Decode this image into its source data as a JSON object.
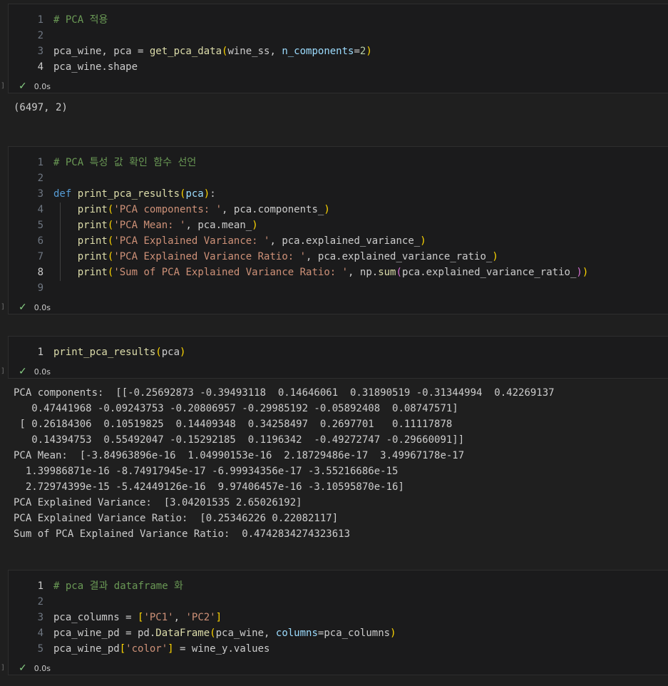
{
  "cells": [
    {
      "lines": [
        {
          "n": "1",
          "parts": [
            [
              "cm",
              "# PCA 적용"
            ]
          ]
        },
        {
          "n": "2",
          "parts": []
        },
        {
          "n": "3",
          "parts": [
            [
              "t",
              "pca_wine, pca = "
            ],
            [
              "fn",
              "get_pca_data"
            ],
            [
              "b1",
              "("
            ],
            [
              "t",
              "wine_ss, "
            ],
            [
              "prm",
              "n_components"
            ],
            [
              "t",
              "="
            ],
            [
              "num",
              "2"
            ],
            [
              "b1",
              ")"
            ]
          ]
        },
        {
          "n": "4",
          "parts": [
            [
              "t",
              "pca_wine.shape"
            ]
          ],
          "active": true
        }
      ],
      "status": "0.0s",
      "output": "(6497, 2)"
    },
    {
      "lines": [
        {
          "n": "1",
          "parts": [
            [
              "cm",
              "# PCA 특성 값 확인 함수 선언"
            ]
          ]
        },
        {
          "n": "2",
          "parts": []
        },
        {
          "n": "3",
          "parts": [
            [
              "kw",
              "def "
            ],
            [
              "fn",
              "print_pca_results"
            ],
            [
              "b1",
              "("
            ],
            [
              "prm",
              "pca"
            ],
            [
              "b1",
              ")"
            ],
            [
              "t",
              ":"
            ]
          ]
        },
        {
          "n": "4",
          "parts": [
            [
              "t",
              "    "
            ],
            [
              "fn",
              "print"
            ],
            [
              "b1",
              "("
            ],
            [
              "str",
              "'PCA components: '"
            ],
            [
              "t",
              ", pca.components_"
            ],
            [
              "b1",
              ")"
            ]
          ]
        },
        {
          "n": "5",
          "parts": [
            [
              "t",
              "    "
            ],
            [
              "fn",
              "print"
            ],
            [
              "b1",
              "("
            ],
            [
              "str",
              "'PCA Mean: '"
            ],
            [
              "t",
              ", pca.mean_"
            ],
            [
              "b1",
              ")"
            ]
          ]
        },
        {
          "n": "6",
          "parts": [
            [
              "t",
              "    "
            ],
            [
              "fn",
              "print"
            ],
            [
              "b1",
              "("
            ],
            [
              "str",
              "'PCA Explained Variance: '"
            ],
            [
              "t",
              ", pca.explained_variance_"
            ],
            [
              "b1",
              ")"
            ]
          ]
        },
        {
          "n": "7",
          "parts": [
            [
              "t",
              "    "
            ],
            [
              "fn",
              "print"
            ],
            [
              "b1",
              "("
            ],
            [
              "str",
              "'PCA Explained Variance Ratio: '"
            ],
            [
              "t",
              ", pca.explained_variance_ratio_"
            ],
            [
              "b1",
              ")"
            ]
          ]
        },
        {
          "n": "8",
          "parts": [
            [
              "t",
              "    "
            ],
            [
              "fn",
              "print"
            ],
            [
              "b1",
              "("
            ],
            [
              "str",
              "'Sum of PCA Explained Variance Ratio: '"
            ],
            [
              "t",
              ", np."
            ],
            [
              "fn",
              "sum"
            ],
            [
              "b2",
              "("
            ],
            [
              "t",
              "pca.explained_variance_ratio_"
            ],
            [
              "b2",
              ")"
            ],
            [
              "b1",
              ")"
            ]
          ],
          "active": true
        },
        {
          "n": "9",
          "parts": []
        }
      ],
      "status": "0.0s",
      "output": ""
    },
    {
      "lines": [
        {
          "n": "1",
          "parts": [
            [
              "fn",
              "print_pca_results"
            ],
            [
              "b1",
              "("
            ],
            [
              "t",
              "pca"
            ],
            [
              "b1",
              ")"
            ]
          ],
          "active": true
        }
      ],
      "status": "0.0s",
      "output": "PCA components:  [[-0.25692873 -0.39493118  0.14646061  0.31890519 -0.31344994  0.42269137\n   0.47441968 -0.09243753 -0.20806957 -0.29985192 -0.05892408  0.08747571]\n [ 0.26184306  0.10519825  0.14409348  0.34258497  0.2697701   0.11117878\n   0.14394753  0.55492047 -0.15292185  0.1196342  -0.49272747 -0.29660091]]\nPCA Mean:  [-3.84963896e-16  1.04990153e-16  2.18729486e-17  3.49967178e-17\n  1.39986871e-16 -8.74917945e-17 -6.99934356e-17 -3.55216686e-15\n  2.72974399e-15 -5.42449126e-16  9.97406457e-16 -3.10595870e-16]\nPCA Explained Variance:  [3.04201535 2.65026192]\nPCA Explained Variance Ratio:  [0.25346226 0.22082117]\nSum of PCA Explained Variance Ratio:  0.4742834274323613"
    },
    {
      "lines": [
        {
          "n": "1",
          "parts": [
            [
              "cm",
              "# pca 결과 dataframe 화"
            ]
          ],
          "active": true
        },
        {
          "n": "2",
          "parts": []
        },
        {
          "n": "3",
          "parts": [
            [
              "t",
              "pca_columns = "
            ],
            [
              "b1",
              "["
            ],
            [
              "str",
              "'PC1'"
            ],
            [
              "t",
              ", "
            ],
            [
              "str",
              "'PC2'"
            ],
            [
              "b1",
              "]"
            ]
          ]
        },
        {
          "n": "4",
          "parts": [
            [
              "t",
              "pca_wine_pd = pd."
            ],
            [
              "fn",
              "DataFrame"
            ],
            [
              "b1",
              "("
            ],
            [
              "t",
              "pca_wine, "
            ],
            [
              "prm",
              "columns"
            ],
            [
              "t",
              "=pca_columns"
            ],
            [
              "b1",
              ")"
            ]
          ]
        },
        {
          "n": "5",
          "parts": [
            [
              "t",
              "pca_wine_pd"
            ],
            [
              "b1",
              "["
            ],
            [
              "str",
              "'color'"
            ],
            [
              "b1",
              "]"
            ],
            [
              "t",
              " = wine_y.values"
            ]
          ]
        }
      ],
      "status": "0.0s",
      "output": ""
    }
  ]
}
